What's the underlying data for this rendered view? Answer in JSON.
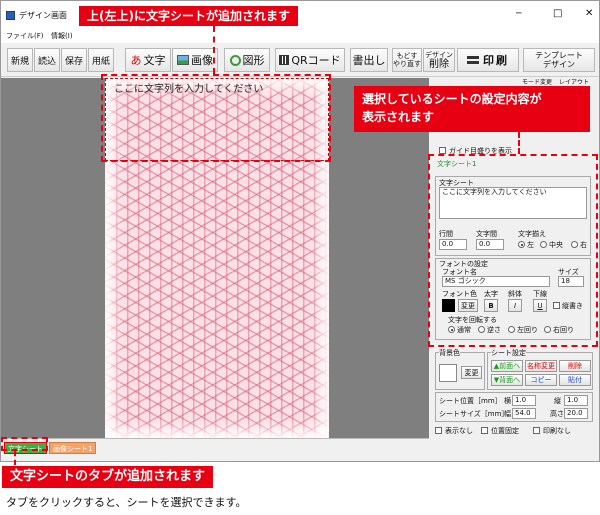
{
  "window": {
    "title": "デザイン画面",
    "minimize": "─",
    "maximize": "□",
    "close": "✕"
  },
  "menu": [
    "ファイル(F)",
    "情報(I)"
  ],
  "toolbar": {
    "new": "新規",
    "open": "読込",
    "save": "保存",
    "paper": "用紙",
    "text": "文字",
    "text_prefix": "あ",
    "image": "画像",
    "shape": "図形",
    "qr": "QRコード",
    "write": "書出し",
    "undo_redo": [
      "もどす",
      "やり直す"
    ],
    "delete_top": "デザイン",
    "delete": "削除",
    "print": "印刷",
    "template": [
      "テンプレート",
      "デザイン"
    ]
  },
  "canvas": {
    "placeholder": "ここに文字列を入力してください"
  },
  "tabs": {
    "text_sheet": "文字シート",
    "image_sheet": "画像シート1"
  },
  "panel": {
    "edit_mode_label": "モード変更",
    "edit_mode_value": "レイアウト",
    "guide": "ガイド目盛りを表示",
    "sheet_title": "文字シート1",
    "text_group": "文字シート",
    "text_value": "ここに文字列を入力してください",
    "line_label": "行間",
    "line_value": "0.0",
    "char_label": "文字間",
    "char_value": "0.0",
    "align_label": "文字揃え",
    "align": [
      "左",
      "中央",
      "右"
    ],
    "font_group": "フォントの設定",
    "font_name_label": "フォント名",
    "font_name": "MS ゴシック",
    "size_label": "サイズ",
    "size": "18",
    "color_label": "フォント色",
    "bold_label": "太字",
    "italic_label": "斜体",
    "underline_label": "下線",
    "change": "変更",
    "bold": "B",
    "italic": "I",
    "underline": "U",
    "vertical": "縦書き",
    "rotate_label": "文字を回転する",
    "rotate": [
      "通常",
      "逆さ",
      "左回り",
      "右回り"
    ],
    "bg_label": "背景色",
    "bg_change": "変更",
    "sheet_setting": "シート設定",
    "front": "▲前面へ",
    "back": "▼背面へ",
    "rename": "名称変更",
    "copy": "コピー",
    "delete": "削除",
    "paste": "貼付",
    "pos_label": "シート位置［mm］",
    "x_label": "横",
    "x": "1.0",
    "y_label": "縦",
    "y": "1.0",
    "size_label2": "シートサイズ［mm］",
    "w_label": "幅",
    "w": "54.0",
    "h_label": "高さ",
    "h": "20.0",
    "hide": "表示なし",
    "lock": "位置固定",
    "noprint": "印刷なし"
  },
  "annotations": {
    "top": "上(左上)に文字シートが追加されます",
    "right": [
      "選択しているシートの設定内容が",
      "表示されます"
    ],
    "bottom": "文字シートのタブが追加されます",
    "note": "タブをクリックすると、シートを選択できます。"
  },
  "colors": {
    "accent": "#e60012"
  }
}
